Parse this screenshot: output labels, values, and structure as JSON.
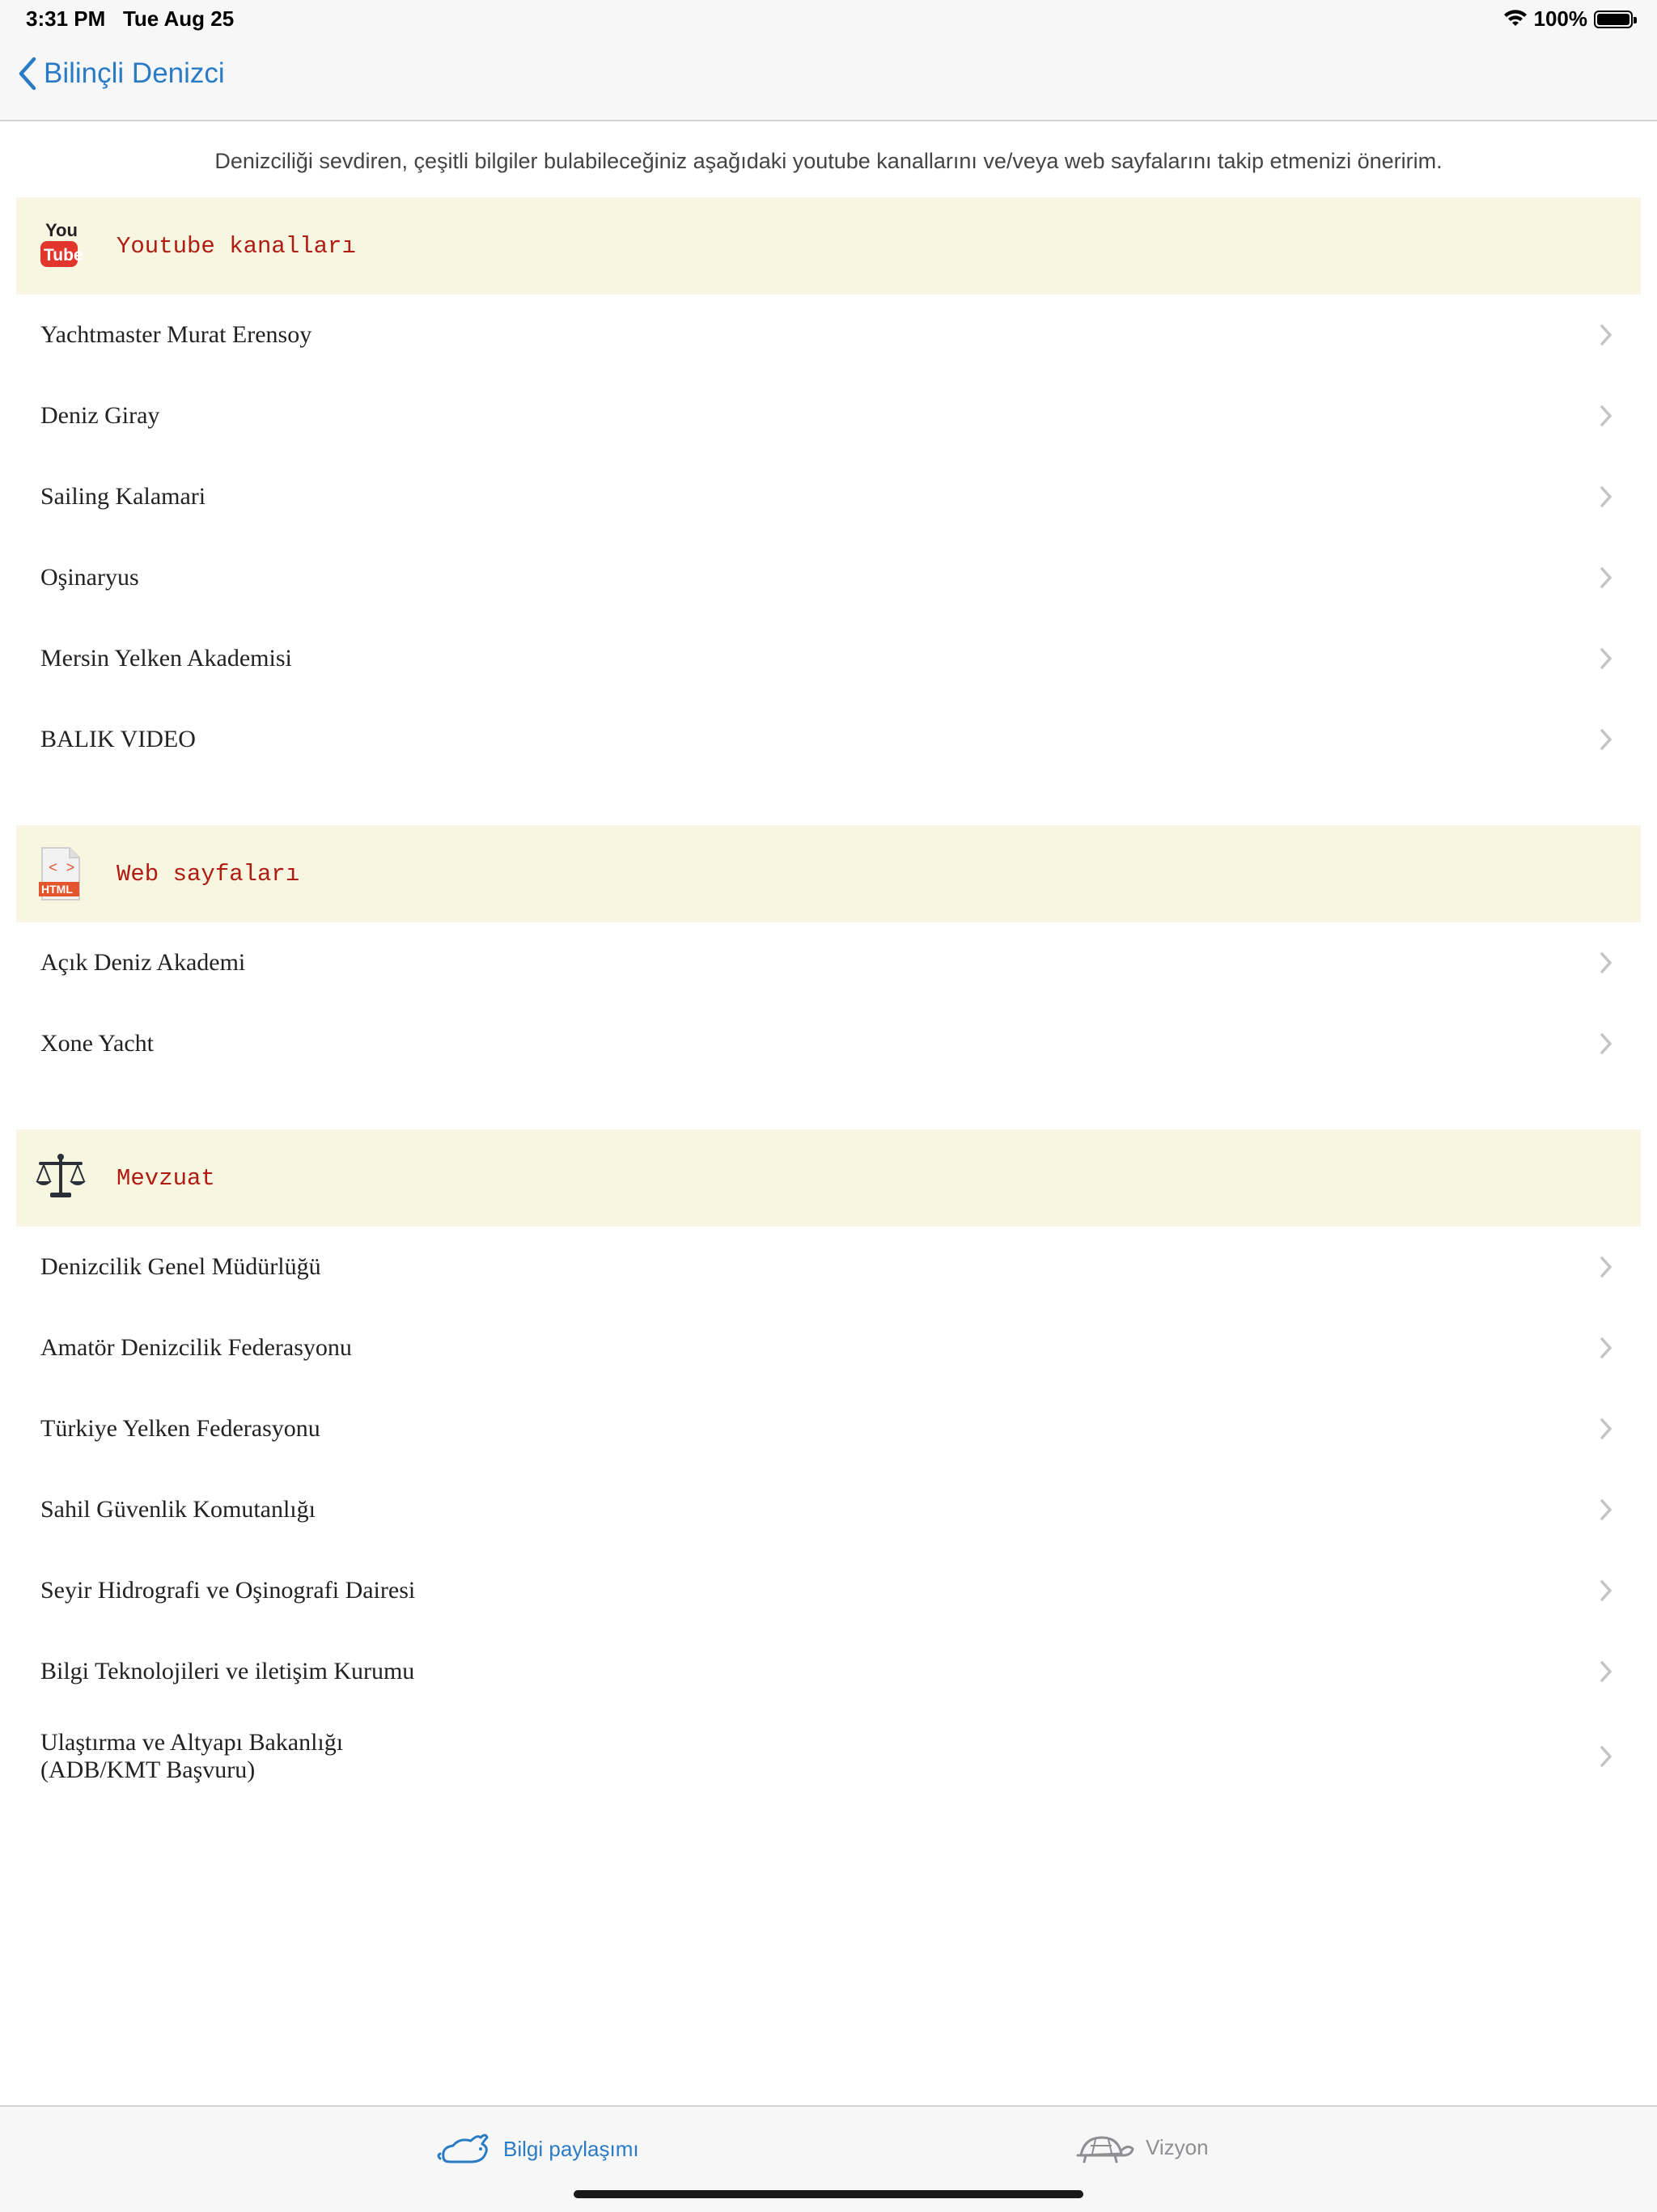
{
  "status": {
    "time": "3:31 PM",
    "date": "Tue Aug 25",
    "battery": "100%",
    "icons": [
      "wifi-icon",
      "battery-icon"
    ]
  },
  "nav": {
    "back_label": "Bilinçli Denizci",
    "icon": "chevron-left-icon",
    "accent": "#2a7bc6"
  },
  "intro": "Denizciliği sevdiren, çeşitli bilgiler bulabileceğiniz aşağıdaki youtube kanallarını ve/veya web sayfalarını takip etmenizi öneririm.",
  "sections": [
    {
      "title": "Youtube kanalları",
      "icon": "youtube-icon",
      "icon_text_top": "You",
      "icon_text_bottom": "Tube",
      "items": [
        "Yachtmaster Murat Erensoy",
        "Deniz Giray",
        "Sailing Kalamari",
        "Oşinaryus",
        "Mersin Yelken Akademisi",
        "BALIK VIDEO"
      ]
    },
    {
      "title": "Web sayfaları",
      "icon": "html-file-icon",
      "icon_text": "HTML",
      "icon_code": "< >",
      "items": [
        "Açık Deniz Akademi",
        "Xone Yacht"
      ]
    },
    {
      "title": "Mevzuat",
      "icon": "scales-icon",
      "items": [
        "Denizcilik Genel Müdürlüğü",
        "Amatör Denizcilik Federasyonu",
        "Türkiye Yelken Federasyonu",
        "Sahil Güvenlik Komutanlığı",
        "Seyir Hidrografi ve Oşinografi Dairesi",
        "Bilgi Teknolojileri ve iletişim Kurumu"
      ],
      "last_item": {
        "line1": "Ulaştırma ve Altyapı Bakanlığı",
        "line2": "(ADB/KMT Başvuru)"
      }
    }
  ],
  "tabs": [
    {
      "label": "Bilgi paylaşımı",
      "icon": "rabbit-icon",
      "selected": true,
      "color": "#2a7bc6"
    },
    {
      "label": "Vizyon",
      "icon": "turtle-icon",
      "selected": false,
      "color": "#8e8e93"
    }
  ],
  "colors": {
    "section_bg": "#f6f6e1",
    "section_title": "#b01b12",
    "chevron": "#c4c4c6"
  }
}
